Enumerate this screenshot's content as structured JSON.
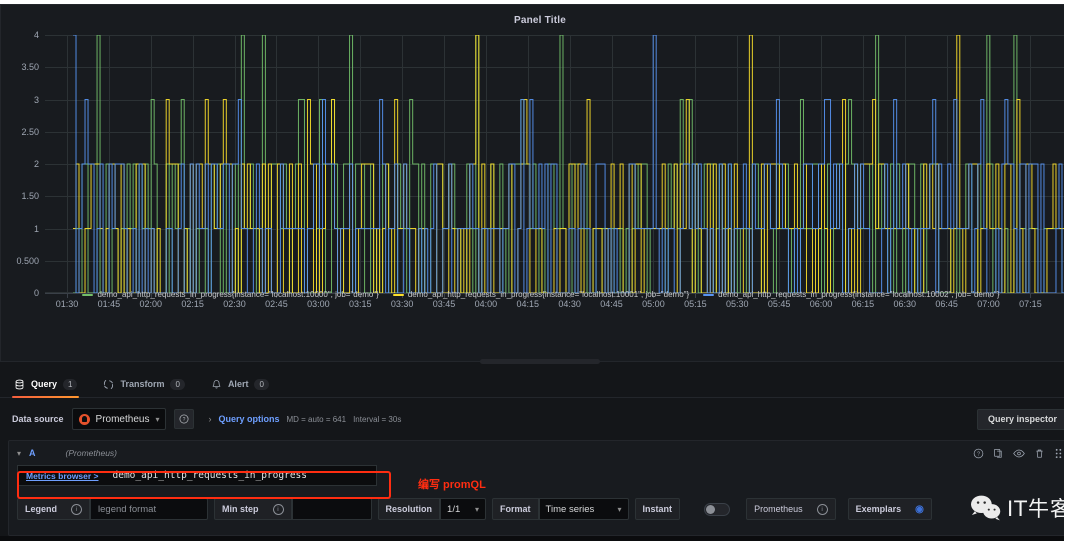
{
  "panel": {
    "title": "Panel Title"
  },
  "chart_data": {
    "type": "line",
    "title": "Panel Title",
    "xlabel": "",
    "ylabel": "",
    "ylim": [
      0,
      4
    ],
    "grid": true,
    "legend_position": "bottom",
    "y_ticks": [
      "0",
      "0.500",
      "1",
      "1.50",
      "2",
      "2.50",
      "3",
      "3.50",
      "4"
    ],
    "y_tick_values": [
      0,
      0.5,
      1,
      1.5,
      2,
      2.5,
      3,
      3.5,
      4
    ],
    "x_ticks": [
      "01:30",
      "01:45",
      "02:00",
      "02:15",
      "02:30",
      "02:45",
      "03:00",
      "03:15",
      "03:30",
      "03:45",
      "04:00",
      "04:15",
      "04:30",
      "04:45",
      "05:00",
      "05:15",
      "05:30",
      "05:45",
      "06:00",
      "06:15",
      "06:30",
      "06:45",
      "07:00",
      "07:15"
    ],
    "series": [
      {
        "name": "demo_api_http_requests_in_progress{instance=\"localhost:10000\", job=\"demo\"}",
        "color": "#73BF69",
        "instance": "localhost:10000",
        "job": "demo",
        "value_range": [
          0,
          4
        ]
      },
      {
        "name": "demo_api_http_requests_in_progress{instance=\"localhost:10001\", job=\"demo\"}",
        "color": "#FADE2A",
        "instance": "localhost:10001",
        "job": "demo",
        "value_range": [
          0,
          4
        ]
      },
      {
        "name": "demo_api_http_requests_in_progress{instance=\"localhost:10002\", job=\"demo\"}",
        "color": "#5794F2",
        "instance": "localhost:10002",
        "job": "demo",
        "value_range": [
          0,
          4
        ]
      }
    ]
  },
  "tabs": [
    {
      "label": "Query",
      "count": "1",
      "icon": "database-icon",
      "active": true
    },
    {
      "label": "Transform",
      "count": "0",
      "icon": "transform-icon",
      "active": false
    },
    {
      "label": "Alert",
      "count": "0",
      "icon": "bell-icon",
      "active": false
    }
  ],
  "datasource_row": {
    "label": "Data source",
    "selected": "Prometheus",
    "help_icon": "help-circle-icon",
    "query_options_label": "Query options",
    "max_data_points": "MD = auto = 641",
    "interval": "Interval = 30s",
    "query_inspector": "Query inspector"
  },
  "query": {
    "ref_id": "A",
    "datasource_note": "(Prometheus)",
    "actions": [
      "help-circle-icon",
      "duplicate-icon",
      "eye-icon",
      "trash-icon",
      "drag-handle-icon"
    ],
    "metrics_browser_label": "Metrics browser >",
    "expression": "demo_api_http_requests_in_progress",
    "options": {
      "legend_label": "Legend",
      "legend_placeholder": "legend format",
      "legend_value": "",
      "min_step_label": "Min step",
      "min_step_value": "",
      "resolution_label": "Resolution",
      "resolution_value": "1/1",
      "format_label": "Format",
      "format_value": "Time series",
      "instant_label": "Instant",
      "instant_on": false,
      "exemplars_datasource": "Prometheus",
      "exemplars_label": "Exemplars"
    }
  },
  "annotation": {
    "text": "编写 promQL",
    "color": "#ff2d11"
  },
  "watermark": {
    "text": "IT牛客",
    "icon": "wechat-icon"
  }
}
